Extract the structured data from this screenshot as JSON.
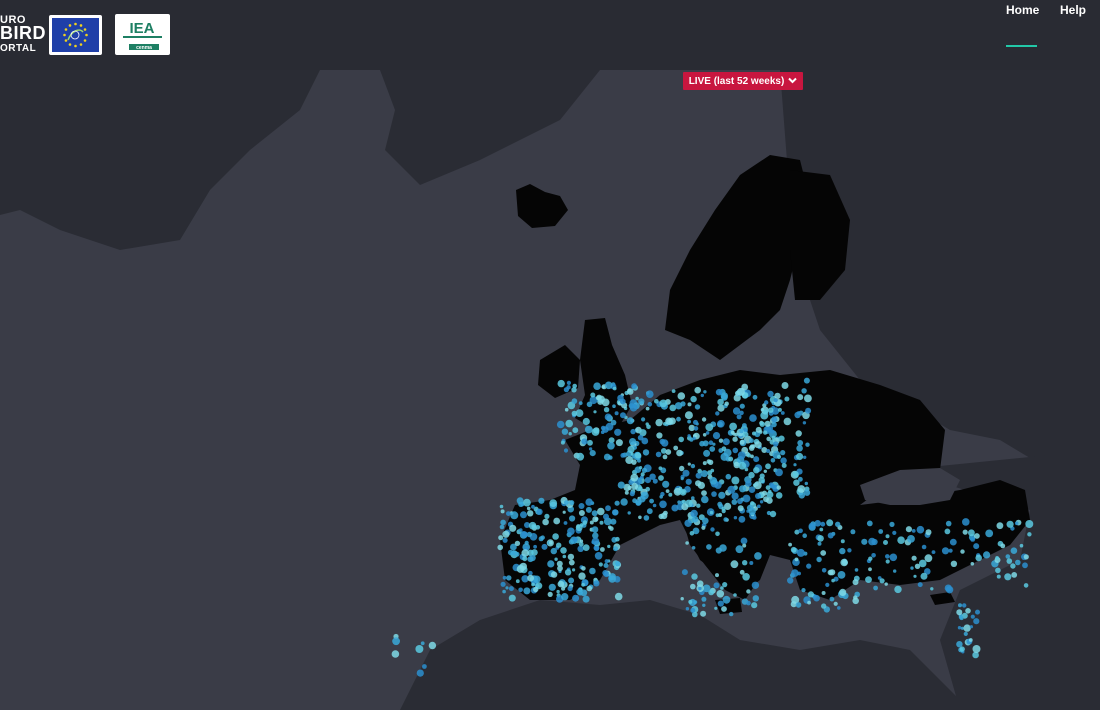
{
  "brand": {
    "line1": "URO",
    "line2": "BIRD",
    "line3": "ORTAL"
  },
  "logos": {
    "eu": {
      "icon": "eu-life-flag-icon"
    },
    "iea": {
      "icon": "iea-logo-icon",
      "text": "IEA",
      "subtext": "cenma"
    }
  },
  "nav": {
    "home": "Home",
    "help": "Help",
    "active": "home"
  },
  "live_filter": {
    "label": "LIVE (last 52 weeks)",
    "icon": "chevron-down-icon"
  },
  "colors": {
    "sea": "#3a3c47",
    "land": "#272930",
    "data_land": "#050505",
    "points_light": "#7fd9e6",
    "points_mid": "#3aa8d8",
    "accent": "#22c8a8",
    "live_red": "#c8163f"
  }
}
